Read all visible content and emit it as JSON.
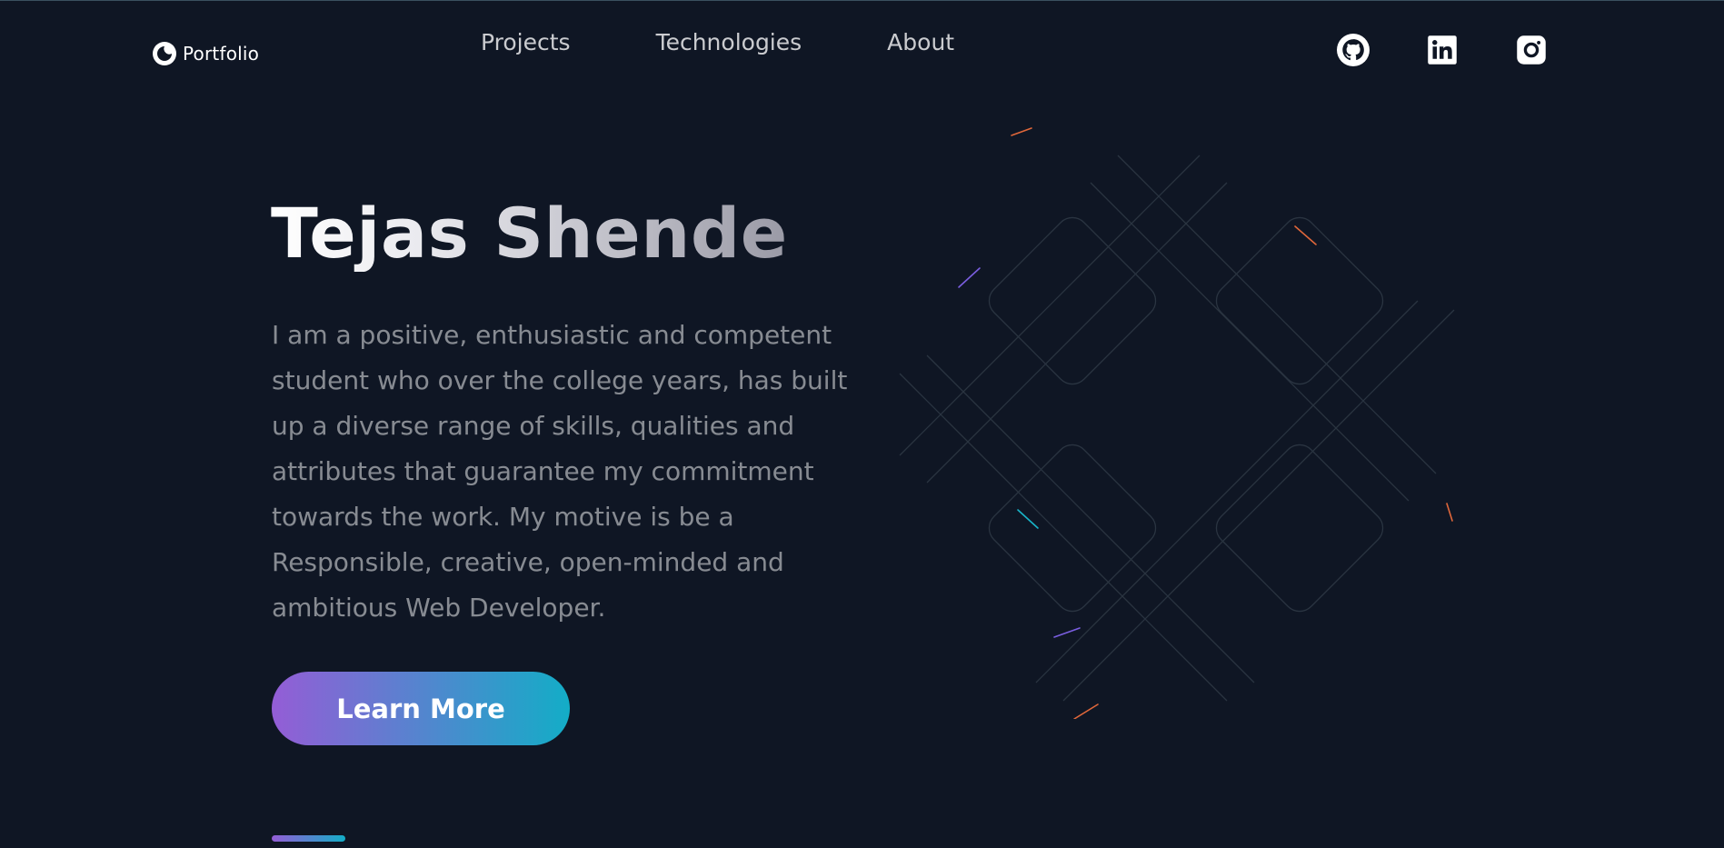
{
  "header": {
    "logo_text": "Portfolio",
    "nav": [
      {
        "label": "Projects"
      },
      {
        "label": "Technologies"
      },
      {
        "label": "About"
      }
    ],
    "socials": [
      {
        "icon": "github-icon"
      },
      {
        "icon": "linkedin-icon"
      },
      {
        "icon": "instagram-icon"
      }
    ]
  },
  "hero": {
    "title": "Tejas Shende",
    "description": "I am a positive, enthusiastic and competent student who over the college years, has built up a diverse range of skills, qualities and attributes that guarantee my commitment towards the work. My motive is be a Responsible, creative, open-minded and ambitious Web Developer.",
    "cta_label": "Learn More"
  },
  "colors": {
    "background": "#0f1624",
    "gradient_start": "#945dd6",
    "gradient_mid": "#6978d1",
    "gradient_end": "#13adc7"
  }
}
